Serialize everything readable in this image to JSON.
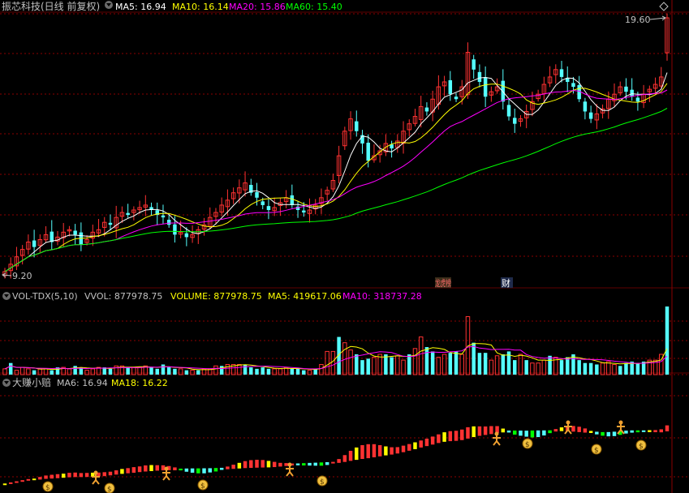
{
  "price_panel": {
    "title": "振芯科技(日线 前复权)",
    "ma": [
      {
        "label": "MA5: 16.94",
        "color": "#ffffff"
      },
      {
        "label": "MA10: 16.14",
        "color": "#ffff00"
      },
      {
        "label": "MA20: 15.86",
        "color": "#ff00ff"
      },
      {
        "label": "MA60: 15.40",
        "color": "#00ff00"
      }
    ],
    "high_label": "19.60",
    "low_label": "9.20",
    "markers": [
      "龙虎榜",
      "财"
    ]
  },
  "volume_panel": {
    "title": "VOL-TDX(5,10)",
    "vvol": "VVOL: 877978.75",
    "volume": "VOLUME: 877978.75",
    "ma5": "MA5: 419617.06",
    "ma10": "MA10: 318737.28"
  },
  "indicator_panel": {
    "title": "大赚小赔",
    "ma6": "MA6: 16.94",
    "ma18": "MA18: 16.22"
  },
  "colors": {
    "up": "#ff3232",
    "down": "#54ffff",
    "grid": "#8b0000",
    "ma5": "#ffffff",
    "ma10": "#ffff00",
    "ma20": "#ff00ff",
    "ma60": "#00ff00"
  },
  "chart_data": [
    {
      "type": "candlestick",
      "title": "振芯科技(日线 前复权)",
      "series": [
        {
          "name": "MA5",
          "last": 16.94
        },
        {
          "name": "MA10",
          "last": 16.14
        },
        {
          "name": "MA20",
          "last": 15.86
        },
        {
          "name": "MA60",
          "last": 15.4
        }
      ],
      "range": {
        "low": 9.2,
        "high": 19.6
      },
      "closes": [
        9.3,
        9.6,
        9.9,
        10.2,
        10.5,
        10.3,
        10.6,
        10.8,
        10.5,
        10.7,
        10.9,
        11.0,
        10.8,
        10.4,
        10.6,
        10.9,
        11.0,
        11.3,
        11.2,
        11.5,
        11.7,
        11.6,
        11.8,
        11.9,
        12.0,
        11.8,
        11.6,
        11.5,
        11.2,
        10.8,
        10.9,
        10.7,
        10.8,
        11.0,
        11.2,
        11.5,
        11.7,
        12.0,
        12.2,
        12.5,
        12.7,
        12.9,
        12.5,
        12.3,
        12.0,
        11.8,
        11.9,
        12.1,
        12.3,
        12.0,
        11.8,
        11.7,
        11.8,
        12.0,
        12.3,
        12.6,
        13.0,
        14.0,
        15.0,
        15.5,
        15.0,
        14.5,
        13.8,
        14.0,
        14.2,
        14.5,
        14.3,
        14.6,
        15.0,
        15.3,
        15.6,
        16.0,
        15.8,
        16.3,
        16.8,
        17.0,
        16.5,
        16.3,
        16.8,
        18.2,
        17.5,
        17.0,
        16.4,
        16.6,
        16.8,
        16.2,
        15.6,
        15.3,
        15.5,
        15.8,
        16.2,
        16.5,
        16.9,
        17.2,
        17.5,
        17.2,
        17.0,
        16.8,
        16.3,
        15.8,
        15.5,
        15.7,
        15.9,
        16.3,
        16.5,
        16.8,
        16.6,
        16.4,
        16.2,
        16.5,
        16.7,
        16.9,
        17.2,
        19.6
      ]
    },
    {
      "type": "bar",
      "title": "VOL-TDX(5,10)",
      "series": [
        {
          "name": "VOLUME",
          "last": 877978.75
        },
        {
          "name": "MA5",
          "last": 419617.06
        },
        {
          "name": "MA10",
          "last": 318737.28
        }
      ],
      "values": [
        0.4,
        0.8,
        0.3,
        0.5,
        0.4,
        0.3,
        0.4,
        0.4,
        0.3,
        0.5,
        0.5,
        0.4,
        0.6,
        0.5,
        0.3,
        0.4,
        0.5,
        0.5,
        0.4,
        0.6,
        0.6,
        0.5,
        0.5,
        0.5,
        0.6,
        0.5,
        0.4,
        0.7,
        0.5,
        0.4,
        0.4,
        0.3,
        0.3,
        0.3,
        0.4,
        0.4,
        0.6,
        0.6,
        0.7,
        0.7,
        0.7,
        0.7,
        0.5,
        0.4,
        0.5,
        0.4,
        0.4,
        0.4,
        0.5,
        0.4,
        0.4,
        0.3,
        0.3,
        0.4,
        0.7,
        1.6,
        1.6,
        2.6,
        2.2,
        1.7,
        1.4,
        1.0,
        1.1,
        1.2,
        1.4,
        1.4,
        1.2,
        1.3,
        1.0,
        1.4,
        1.8,
        2.6,
        1.9,
        1.6,
        1.2,
        1.4,
        1.5,
        1.6,
        1.4,
        4.0,
        2.2,
        1.5,
        1.5,
        1.0,
        1.3,
        1.4,
        1.6,
        1.0,
        1.4,
        1.0,
        0.8,
        0.8,
        1.0,
        1.3,
        1.2,
        1.0,
        1.2,
        1.4,
        1.0,
        0.8,
        0.8,
        0.7,
        0.8,
        0.9,
        0.7,
        0.6,
        0.8,
        0.9,
        0.8,
        0.9,
        1.0,
        1.0,
        1.4,
        4.7
      ]
    },
    {
      "type": "line",
      "title": "大赚小赔",
      "series": [
        {
          "name": "MA6",
          "last": 16.94
        },
        {
          "name": "MA18",
          "last": 16.22
        }
      ]
    }
  ]
}
